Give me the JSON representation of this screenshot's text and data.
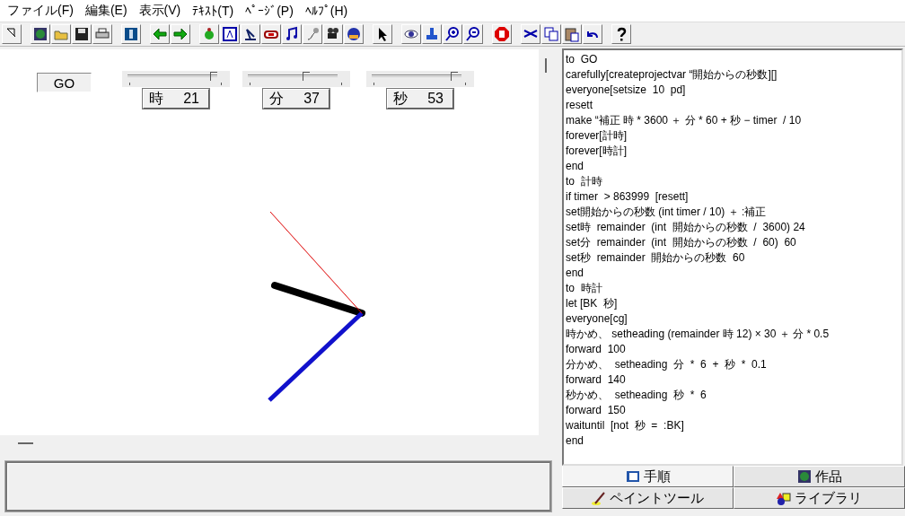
{
  "menu_bar": [
    "ファイル(F)",
    "編集(E)",
    "表示(V)",
    "ﾃｷｽﾄ(T)",
    "ﾍﾟｰｼﾞ(P)",
    "ﾍﾙﾌﾟ(H)"
  ],
  "canvas": {
    "go_button": "GO",
    "sliders": [
      {
        "label": "時",
        "value": "21",
        "level": 0.94
      },
      {
        "label": "分",
        "value": "37",
        "level": 0.63
      },
      {
        "label": "秒",
        "value": "53",
        "level": 0.9
      }
    ]
  },
  "procedures": [
    "to  GO",
    "carefully[createprojectvar “開始からの秒数][]",
    "everyone[setsize  10  pd]",
    "resett",
    "make “補正 時 * 3600 ＋ 分 * 60 + 秒 − timer  / 10",
    "forever[計時]",
    "forever[時計]",
    "end",
    "to  計時",
    "if timer  > 863999  [resett]",
    "set開始からの秒数 (int timer / 10) ＋ :補正",
    "set時  remainder  (int  開始からの秒数  /  3600) 24",
    "set分  remainder  (int  開始からの秒数  /  60)  60",
    "set秒  remainder  開始からの秒数  60",
    "end",
    "to  時計",
    "let [BK  秒]",
    "everyone[cg]",
    "時かめ、 setheading (remainder 時 12) × 30 ＋ 分 * 0.5",
    "forward  100",
    "分かめ、  setheading  分  *  6  +  秒  *  0.1",
    "forward  140",
    "秒かめ、  setheading  秒  *  6",
    "forward  150",
    "waituntil  [not  秒  =  :BK]",
    "end"
  ],
  "tabs": [
    [
      {
        "label": "手順",
        "kind": "book",
        "selected": true
      },
      {
        "label": "作品",
        "kind": "globe",
        "selected": false
      }
    ],
    [
      {
        "label": "ペイントツール",
        "kind": "brush",
        "selected": false
      },
      {
        "label": "ライブラリ",
        "kind": "shapes",
        "selected": false
      }
    ]
  ]
}
